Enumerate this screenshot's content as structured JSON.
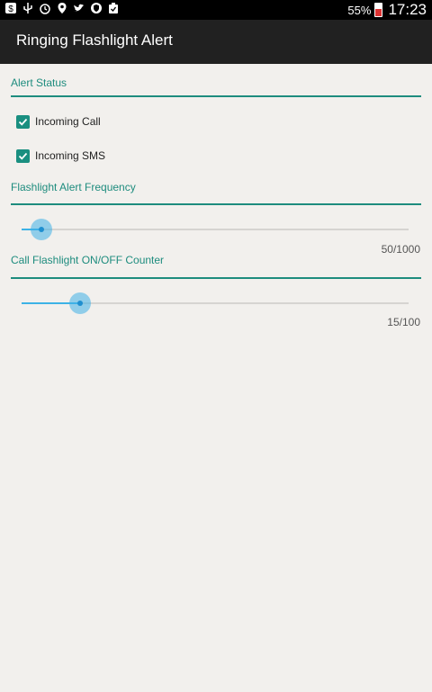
{
  "status_bar": {
    "icons": [
      "dollar-icon",
      "usb-icon",
      "alarm-icon",
      "location-icon",
      "twitter-icon",
      "shield-icon",
      "clipboard-icon"
    ],
    "battery": "55%",
    "time": "17:23"
  },
  "app_bar": {
    "title": "Ringing Flashlight Alert"
  },
  "alert_status": {
    "title": "Alert Status",
    "items": [
      {
        "label": "Incoming Call",
        "checked": true
      },
      {
        "label": "Incoming SMS",
        "checked": true
      }
    ]
  },
  "frequency": {
    "title": "Flashlight Alert Frequency",
    "value_text": "50/1000",
    "value": 50,
    "max": 1000
  },
  "counter": {
    "title": "Call Flashlight ON/OFF Counter",
    "value_text": "15/100",
    "value": 15,
    "max": 100
  },
  "colors": {
    "accent": "#1e8c7e",
    "seek": "#3db2e6",
    "background": "#f2f0ed"
  }
}
